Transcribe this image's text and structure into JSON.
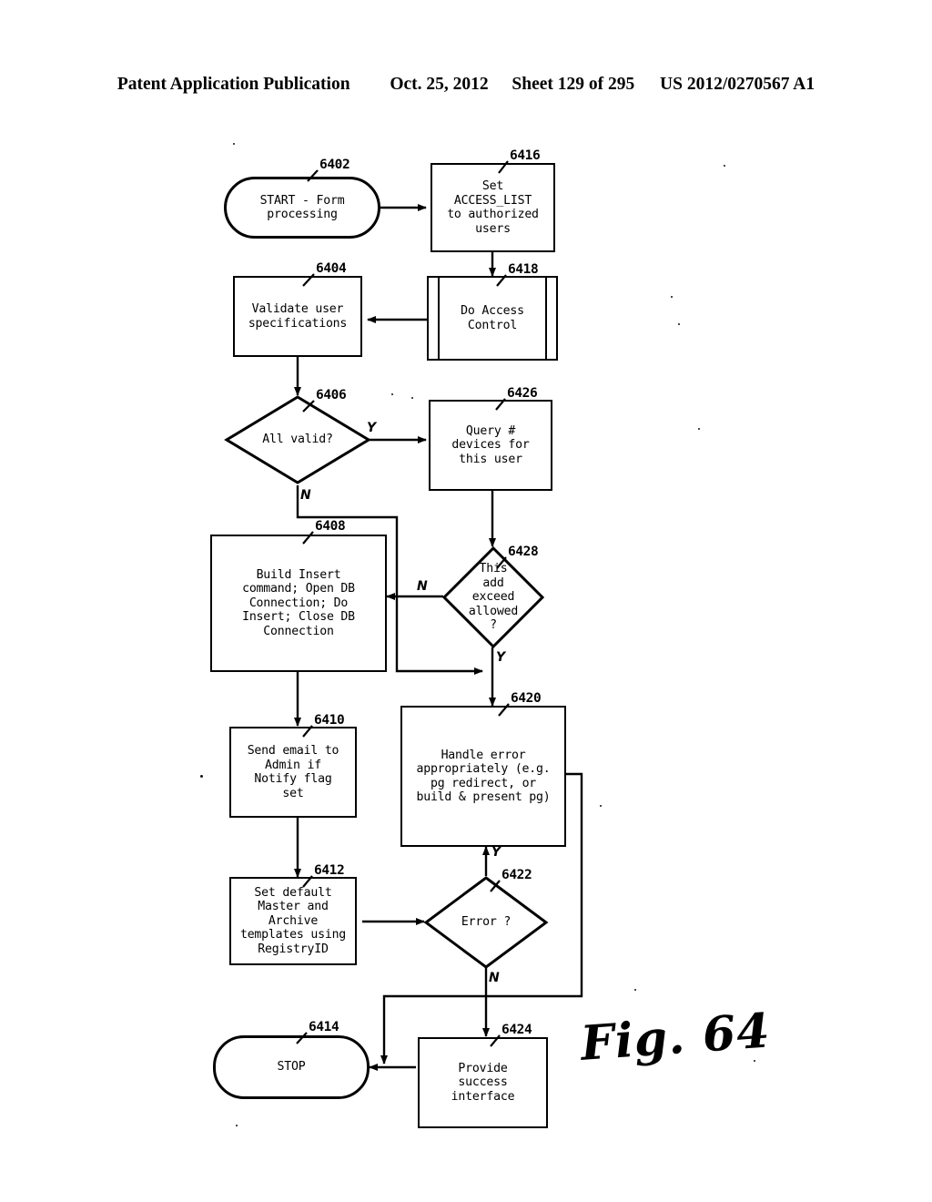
{
  "header": {
    "publication": "Patent Application Publication",
    "date": "Oct. 25, 2012",
    "sheet": "Sheet 129 of 295",
    "pub_number": "US 2012/0270567 A1"
  },
  "figure": {
    "caption": "Fig. 64",
    "type": "flowchart"
  },
  "nodes": [
    {
      "id": "6402",
      "ref": "6402",
      "shape": "terminator",
      "text": "START - Form\nprocessing"
    },
    {
      "id": "6416",
      "ref": "6416",
      "shape": "process",
      "text": "Set\nACCESS_LIST\nto authorized\nusers"
    },
    {
      "id": "6404",
      "ref": "6404",
      "shape": "process",
      "text": "Validate user\nspecifications"
    },
    {
      "id": "6418",
      "ref": "6418",
      "shape": "predefined",
      "text": "Do Access\nControl"
    },
    {
      "id": "6406",
      "ref": "6406",
      "shape": "decision",
      "text": "All valid?"
    },
    {
      "id": "6426",
      "ref": "6426",
      "shape": "process",
      "text": "Query #\ndevices for\nthis user"
    },
    {
      "id": "6408",
      "ref": "6408",
      "shape": "process",
      "text": "Build Insert\ncommand; Open DB\nConnection; Do\nInsert; Close DB\nConnection"
    },
    {
      "id": "6428",
      "ref": "6428",
      "shape": "decision",
      "text": "This\nadd\nexceed\nallowed\n?"
    },
    {
      "id": "6410",
      "ref": "6410",
      "shape": "process",
      "text": "Send email to\nAdmin if\nNotify flag\nset"
    },
    {
      "id": "6420",
      "ref": "6420",
      "shape": "process",
      "text": "Handle error\nappropriately (e.g.\npg redirect, or\nbuild & present pg)"
    },
    {
      "id": "6412",
      "ref": "6412",
      "shape": "process",
      "text": "Set default\nMaster and\nArchive\ntemplates using\nRegistryID"
    },
    {
      "id": "6422",
      "ref": "6422",
      "shape": "decision",
      "text": "Error ?"
    },
    {
      "id": "6414",
      "ref": "6414",
      "shape": "terminator",
      "text": "STOP"
    },
    {
      "id": "6424",
      "ref": "6424",
      "shape": "process",
      "text": "Provide\nsuccess\ninterface"
    }
  ],
  "branch_labels": {
    "all_valid_yes": "Y",
    "all_valid_no": "N",
    "exceed_no": "N",
    "exceed_yes": "Y",
    "error_yes": "Y",
    "error_no": "N"
  }
}
